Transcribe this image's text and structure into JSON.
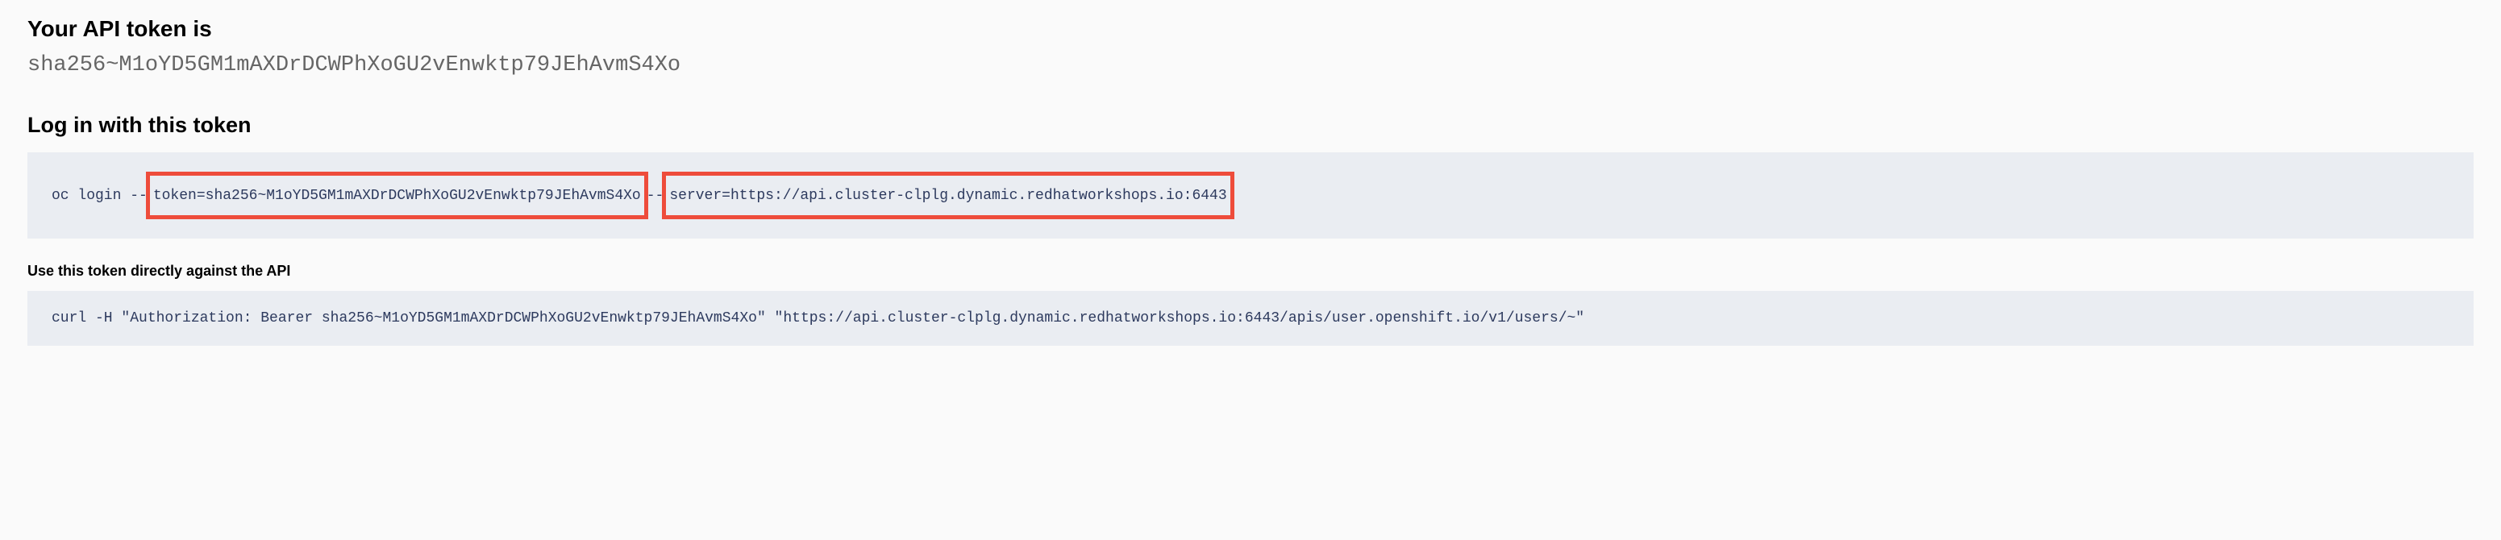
{
  "headings": {
    "apiTokenTitle": "Your API token is",
    "loginTitle": "Log in with this token",
    "useDirectlyTitle": "Use this token directly against the API"
  },
  "token": {
    "value": "sha256~M1oYD5GM1mAXDrDCWPhXoGU2vEnwktp79JEhAvmS4Xo"
  },
  "loginCommand": {
    "prefix": "oc login --",
    "tokenPart": "token=sha256~M1oYD5GM1mAXDrDCWPhXoGU2vEnwktp79JEhAvmS4Xo",
    "middle": " --",
    "serverPart": "server=https://api.cluster-clplg.dynamic.redhatworkshops.io:6443"
  },
  "curlCommand": {
    "full": "curl -H \"Authorization: Bearer sha256~M1oYD5GM1mAXDrDCWPhXoGU2vEnwktp79JEhAvmS4Xo\" \"https://api.cluster-clplg.dynamic.redhatworkshops.io:6443/apis/user.openshift.io/v1/users/~\""
  }
}
